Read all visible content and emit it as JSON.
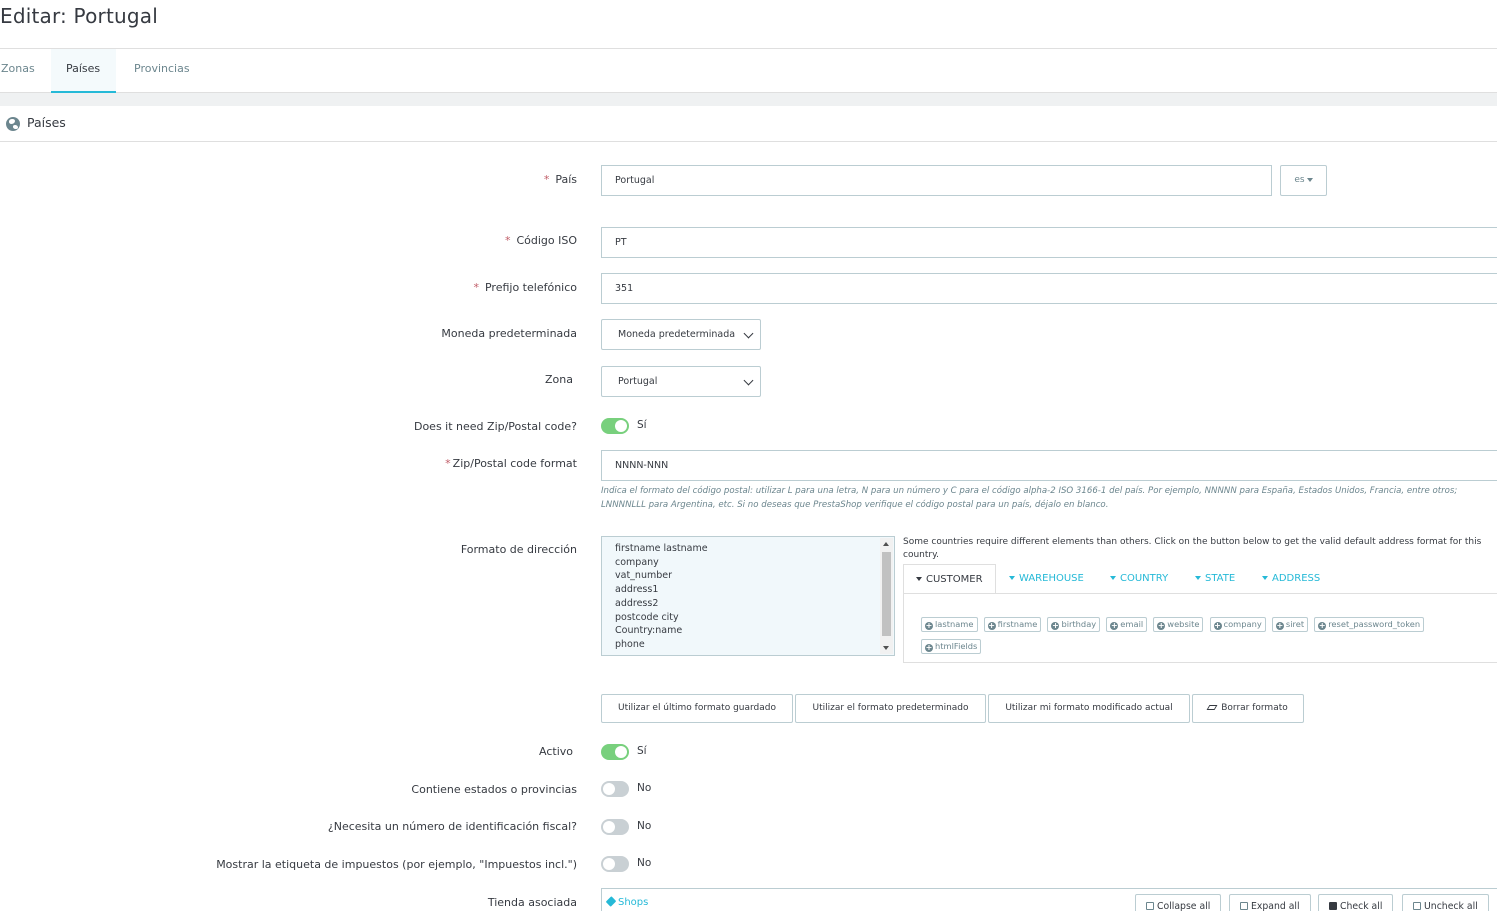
{
  "page": {
    "title": "Editar: Portugal"
  },
  "tabs": [
    {
      "label": "Zonas"
    },
    {
      "label": "Países"
    },
    {
      "label": "Provincias"
    }
  ],
  "panel": {
    "title": "Países"
  },
  "form": {
    "country": {
      "label": "País",
      "value": "Portugal",
      "lang": "es"
    },
    "iso": {
      "label": "Código ISO",
      "value": "PT"
    },
    "phone_prefix": {
      "label": "Prefijo telefónico",
      "value": "351"
    },
    "currency": {
      "label": "Moneda predeterminada",
      "value": "Moneda predeterminada"
    },
    "zone": {
      "label": "Zona",
      "value": "Portugal"
    },
    "need_zip": {
      "label": "Does it need Zip/Postal code?",
      "state": "Sí"
    },
    "zip_format": {
      "label": "Zip/Postal code format",
      "value": "NNNN-NNN",
      "help": "Indica el formato del código postal: utilizar L para una letra, N para un número y C para el código alpha-2 ISO 3166-1 del país. Por ejemplo, NNNNN para España, Estados Unidos, Francia, entre otros; LNNNNLLL para Argentina, etc. Si no deseas que PrestaShop verifique el código postal para un país, déjalo en blanco."
    },
    "address_format": {
      "label": "Formato de dirección",
      "lines": [
        "firstname lastname",
        "company",
        "vat_number",
        "address1",
        "address2",
        "postcode city",
        "Country:name",
        "phone"
      ],
      "help": "Some countries require different elements than others. Click on the button below to get the valid default address format for this country.",
      "tabs": [
        "CUSTOMER",
        "WAREHOUSE",
        "COUNTRY",
        "STATE",
        "ADDRESS"
      ],
      "fields": [
        "lastname",
        "firstname",
        "birthday",
        "email",
        "website",
        "company",
        "siret",
        "reset_password_token",
        "htmlFields"
      ]
    },
    "buttons": {
      "last_saved": "Utilizar el último formato guardado",
      "default_format": "Utilizar el formato predeterminado",
      "current_modified": "Utilizar mi formato modificado actual",
      "clear": "Borrar formato"
    },
    "active": {
      "label": "Activo",
      "state": "Sí"
    },
    "contains_states": {
      "label": "Contiene estados o provincias",
      "state": "No"
    },
    "need_tax_id": {
      "label": "¿Necesita un número de identificación fiscal?",
      "state": "No"
    },
    "display_tax_label": {
      "label": "Mostrar la etiqueta de impuestos (por ejemplo, \"Impuestos incl.\")",
      "state": "No"
    },
    "shop_association": {
      "label": "Tienda asociada",
      "link": "Shops",
      "collapse": "Collapse all",
      "expand": "Expand all",
      "check": "Check all",
      "uncheck": "Uncheck all"
    }
  },
  "colors": {
    "accent": "#25b9d7",
    "switch_on": "#78d07d",
    "required": "#c05c67"
  }
}
